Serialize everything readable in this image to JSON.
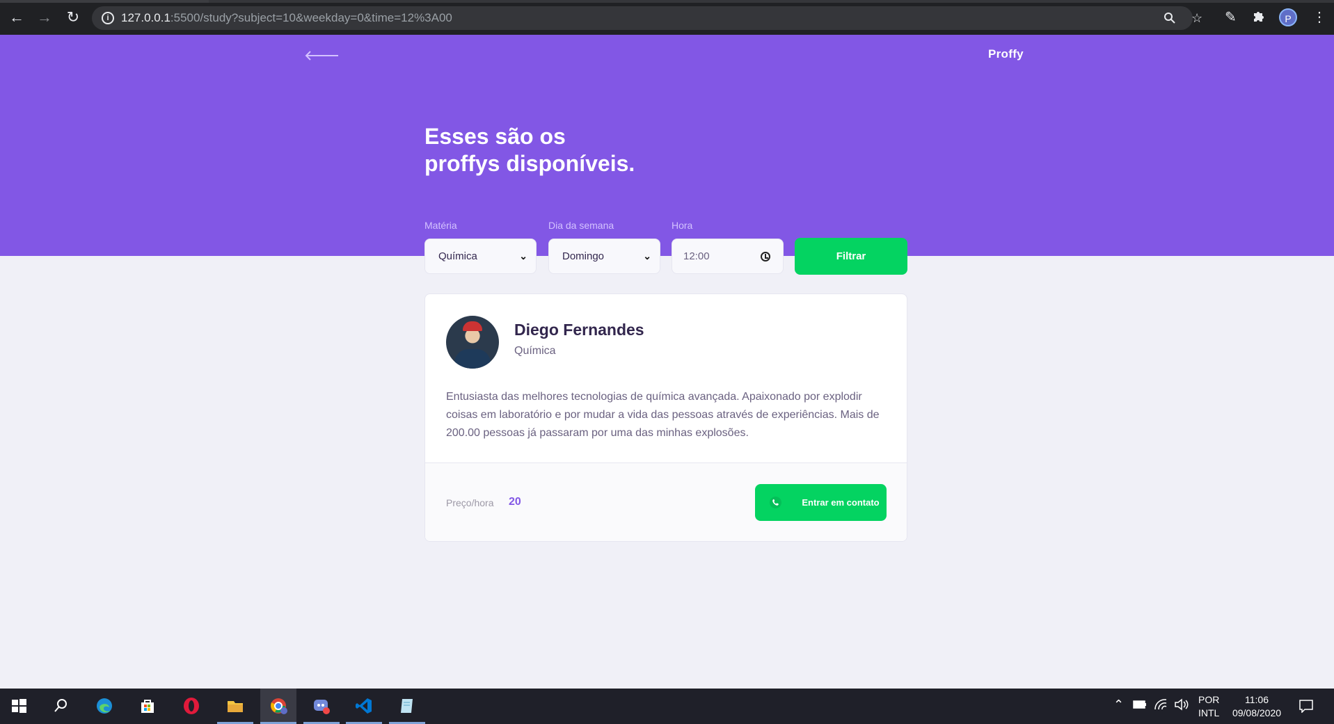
{
  "browser": {
    "url_host": "127.0.0.1",
    "url_rest": ":5500/study?subject=10&weekday=0&time=12%3A00",
    "profile_initial": "P"
  },
  "header": {
    "brand": "Proffy"
  },
  "hero": {
    "title_line1": "Esses são os",
    "title_line2": "proffys disponíveis."
  },
  "filters": {
    "subject_label": "Matéria",
    "subject_value": "Química",
    "weekday_label": "Dia da semana",
    "weekday_value": "Domingo",
    "time_label": "Hora",
    "time_value": "12:00",
    "submit_label": "Filtrar"
  },
  "teacher": {
    "name": "Diego Fernandes",
    "subject": "Química",
    "bio": "Entusiasta das melhores tecnologias de química avançada. Apaixonado por explodir coisas em laboratório e por mudar a vida das pessoas através de experiências. Mais de 200.00 pessoas já passaram por uma das minhas explosões.",
    "price_label": "Preço/hora",
    "price_value": "20",
    "contact_label": "Entrar em contato"
  },
  "taskbar": {
    "lang_line1": "POR",
    "lang_line2": "INTL",
    "time": "11:06",
    "date": "09/08/2020"
  },
  "colors": {
    "primary": "#8257e5",
    "secondary": "#04d361",
    "background": "#f0f0f7"
  }
}
